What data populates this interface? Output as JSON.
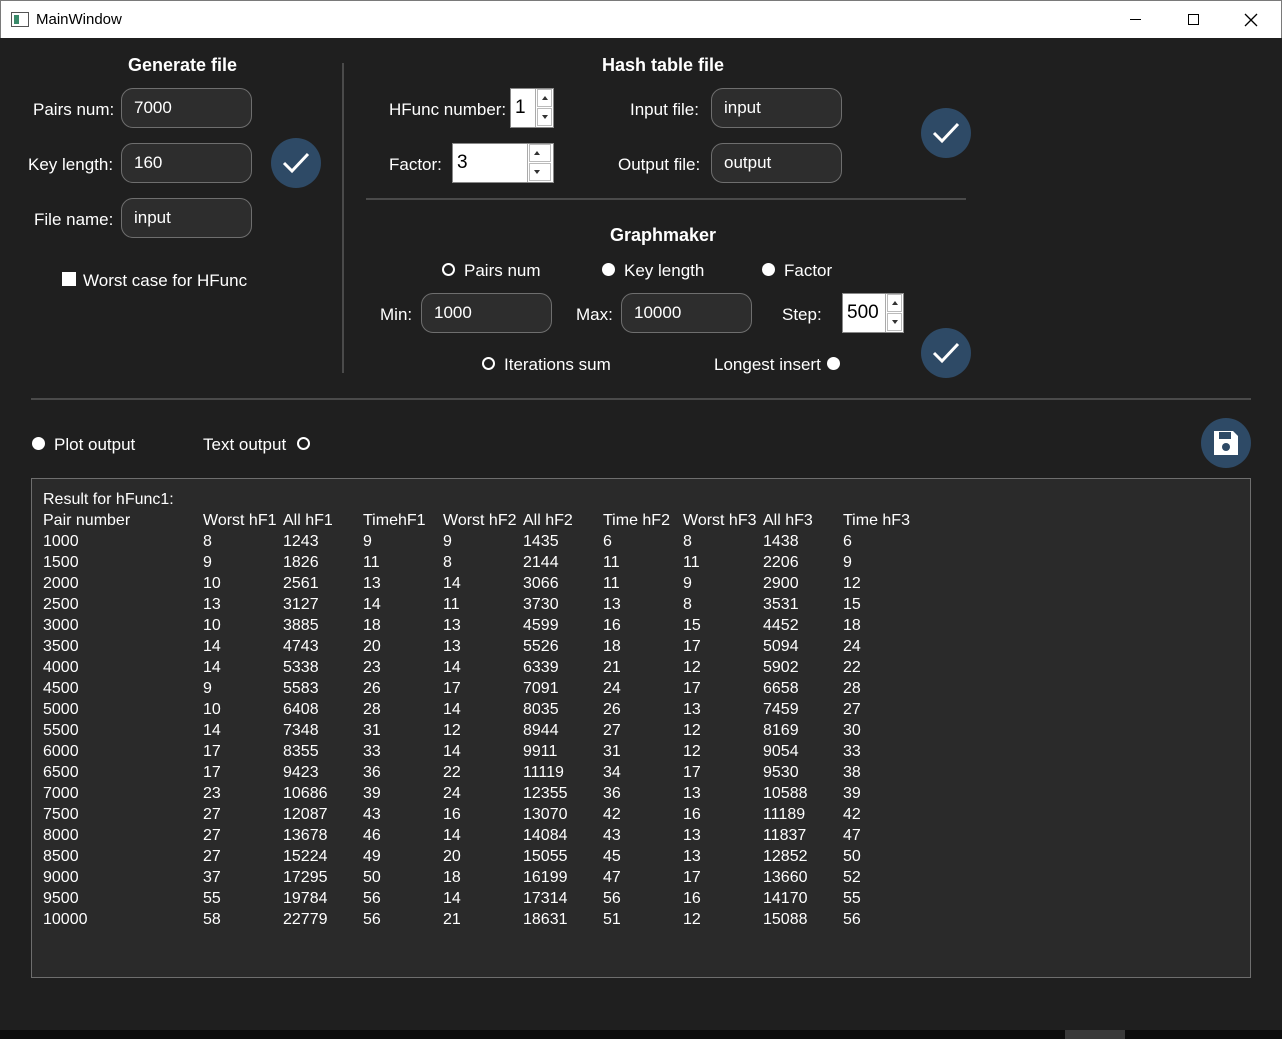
{
  "window": {
    "title": "MainWindow"
  },
  "generate": {
    "heading": "Generate file",
    "pairs_label": "Pairs num:",
    "pairs_value": "7000",
    "key_label": "Key length:",
    "key_value": "160",
    "file_label": "File name:",
    "file_value": "input",
    "worst_case_label": "Worst case for HFunc",
    "worst_case_checked": true
  },
  "hash": {
    "heading": "Hash table file",
    "hfunc_label": "HFunc number:",
    "hfunc_value": "1",
    "factor_label": "Factor:",
    "factor_value": "3",
    "input_label": "Input file:",
    "input_value": "input",
    "output_label": "Output file:",
    "output_value": "output"
  },
  "graph": {
    "heading": "Graphmaker",
    "radio_pairs": "Pairs num",
    "radio_key": "Key length",
    "radio_factor": "Factor",
    "min_label": "Min:",
    "min_value": "1000",
    "max_label": "Max:",
    "max_value": "10000",
    "step_label": "Step:",
    "step_value": "500",
    "radio_iter": "Iterations sum",
    "radio_longest": "Longest insert"
  },
  "output_mode": {
    "plot_label": "Plot output",
    "text_label": "Text output"
  },
  "results": {
    "title": "Result for hFunc1:",
    "headers": [
      "Pair number",
      "Worst hF1",
      "All hF1",
      "TimehF1",
      "Worst hF2",
      "All hF2",
      "Time hF2",
      "Worst hF3",
      "All hF3",
      "Time hF3"
    ],
    "rows": [
      [
        "1000",
        "8",
        "1243",
        "9",
        "9",
        "1435",
        "6",
        "8",
        "1438",
        "6"
      ],
      [
        "1500",
        "9",
        "1826",
        "11",
        "8",
        "2144",
        "11",
        "11",
        "2206",
        "9"
      ],
      [
        "2000",
        "10",
        "2561",
        "13",
        "14",
        "3066",
        "11",
        "9",
        "2900",
        "12"
      ],
      [
        "2500",
        "13",
        "3127",
        "14",
        "11",
        "3730",
        "13",
        "8",
        "3531",
        "15"
      ],
      [
        "3000",
        "10",
        "3885",
        "18",
        "13",
        "4599",
        "16",
        "15",
        "4452",
        "18"
      ],
      [
        "3500",
        "14",
        "4743",
        "20",
        "13",
        "5526",
        "18",
        "17",
        "5094",
        "24"
      ],
      [
        "4000",
        "14",
        "5338",
        "23",
        "14",
        "6339",
        "21",
        "12",
        "5902",
        "22"
      ],
      [
        "4500",
        "9",
        "5583",
        "26",
        "17",
        "7091",
        "24",
        "17",
        "6658",
        "28"
      ],
      [
        "5000",
        "10",
        "6408",
        "28",
        "14",
        "8035",
        "26",
        "13",
        "7459",
        "27"
      ],
      [
        "5500",
        "14",
        "7348",
        "31",
        "12",
        "8944",
        "27",
        "12",
        "8169",
        "30"
      ],
      [
        "6000",
        "17",
        "8355",
        "33",
        "14",
        "9911",
        "31",
        "12",
        "9054",
        "33"
      ],
      [
        "6500",
        "17",
        "9423",
        "36",
        "22",
        "11119",
        "34",
        "17",
        "9530",
        "38"
      ],
      [
        "7000",
        "23",
        "10686",
        "39",
        "24",
        "12355",
        "36",
        "13",
        "10588",
        "39"
      ],
      [
        "7500",
        "27",
        "12087",
        "43",
        "16",
        "13070",
        "42",
        "16",
        "11189",
        "42"
      ],
      [
        "8000",
        "27",
        "13678",
        "46",
        "14",
        "14084",
        "43",
        "13",
        "11837",
        "47"
      ],
      [
        "8500",
        "27",
        "15224",
        "49",
        "20",
        "15055",
        "45",
        "13",
        "12852",
        "50"
      ],
      [
        "9000",
        "37",
        "17295",
        "50",
        "18",
        "16199",
        "47",
        "17",
        "13660",
        "52"
      ],
      [
        "9500",
        "55",
        "19784",
        "56",
        "14",
        "17314",
        "56",
        "16",
        "14170",
        "55"
      ],
      [
        "10000",
        "58",
        "22779",
        "56",
        "21",
        "18631",
        "51",
        "12",
        "15088",
        "56"
      ]
    ]
  },
  "colors": {
    "background": "#1f1f1f",
    "accent_button": "#2e4a66",
    "field_bg": "#2d2d2d"
  }
}
